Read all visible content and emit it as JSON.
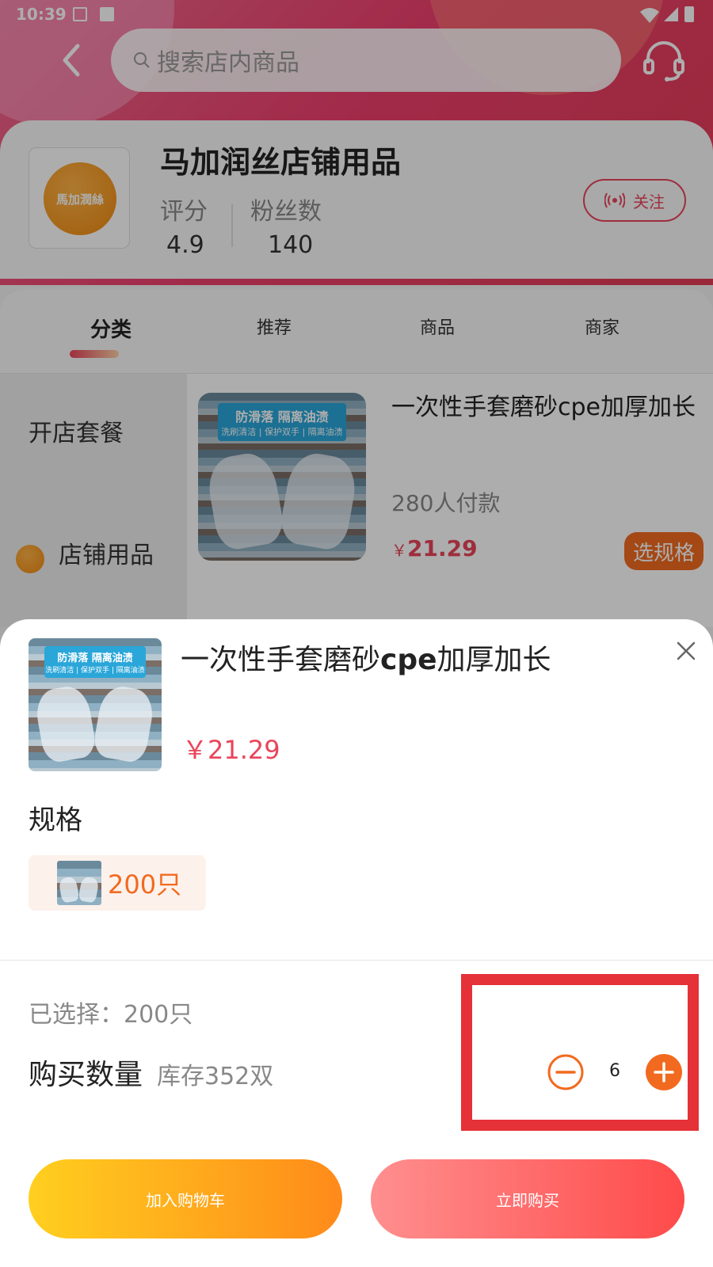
{
  "status_bar": {
    "time": "10:39"
  },
  "header": {
    "search_placeholder": "搜索店内商品",
    "icons": [
      "back-arrow-icon",
      "search-icon",
      "headset-icon"
    ]
  },
  "store": {
    "name": "马加润丝店铺用品",
    "logo_text": "馬加潤絲",
    "rating_label": "评分",
    "rating_value": "4.9",
    "fans_label": "粉丝数",
    "fans_value": "140",
    "follow_label": "关注"
  },
  "tabs": [
    "分类",
    "推荐",
    "商品",
    "商家"
  ],
  "sidebar": {
    "items": [
      "开店套餐",
      "店铺用品"
    ]
  },
  "product": {
    "image_banner_1": "防滑落 隔离油渍",
    "image_banner_2": "洗刷清洁 | 保护双手 | 隔离油渍",
    "title": "一次性手套磨砂cpe加厚加长",
    "sales": "280人付款",
    "price_currency": "￥",
    "price": "21.29",
    "spec_button": "选规格"
  },
  "sheet": {
    "title_pre": "一次性手套磨砂",
    "title_bold": "cpe",
    "title_post": "加厚加长",
    "price": "￥21.29",
    "spec_heading": "规格",
    "spec_option": "200只",
    "selected": "已选择：200只",
    "quantity_label": "购买数量",
    "stock": "库存352双",
    "quantity": "6",
    "add_to_cart": "加入购物车",
    "buy_now": "立即购买"
  },
  "colors": {
    "accent": "#e9455a",
    "orange": "#f26a1f",
    "highlight": "#e53138"
  }
}
